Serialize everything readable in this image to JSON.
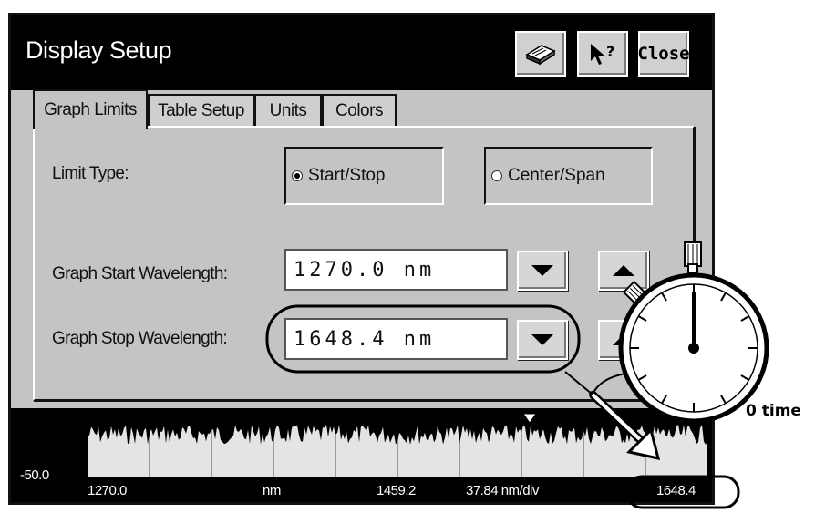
{
  "window": {
    "title": "Display Setup"
  },
  "toolbar": {
    "book_icon": "book-icon",
    "help_icon": "pointer-help-icon",
    "close_label": "Close"
  },
  "tabs": [
    {
      "label": "Graph Limits",
      "active": true
    },
    {
      "label": "Table Setup",
      "active": false
    },
    {
      "label": "Units",
      "active": false
    },
    {
      "label": "Colors",
      "active": false
    }
  ],
  "limit_type": {
    "label": "Limit Type:",
    "options": [
      {
        "label": "Start/Stop",
        "selected": true
      },
      {
        "label": "Center/Span",
        "selected": false
      }
    ]
  },
  "start": {
    "label": "Graph Start Wavelength:",
    "value": "1270.0 nm"
  },
  "stop": {
    "label": "Graph Stop Wavelength:",
    "value": "1648.4 nm"
  },
  "spectrum": {
    "ref_level": "-50.0",
    "start": "1270.0",
    "unit": "nm",
    "center": "1459.2",
    "scale": "37.84 nm/div",
    "stop": "1648.4"
  },
  "annotation": {
    "timer_label": "0 time"
  },
  "colors": {
    "titlebar": "#000000",
    "panel": "#c4c4c4",
    "plot_bg": "#e4e4e4"
  }
}
